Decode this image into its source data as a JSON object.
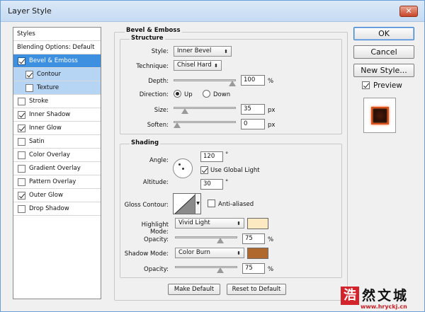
{
  "window": {
    "title": "Layer Style",
    "close": "✕"
  },
  "styles_panel": {
    "items": [
      {
        "label": "Styles",
        "kind": "plain"
      },
      {
        "label": "Blending Options: Default",
        "kind": "plain"
      },
      {
        "label": "Bevel & Emboss",
        "kind": "check",
        "checked": true,
        "state": "selected"
      },
      {
        "label": "Contour",
        "kind": "sub",
        "checked": true,
        "state": "sub-selected"
      },
      {
        "label": "Texture",
        "kind": "sub",
        "checked": false,
        "state": "sub-selected"
      },
      {
        "label": "Stroke",
        "kind": "check",
        "checked": false
      },
      {
        "label": "Inner Shadow",
        "kind": "check",
        "checked": true
      },
      {
        "label": "Inner Glow",
        "kind": "check",
        "checked": true
      },
      {
        "label": "Satin",
        "kind": "check",
        "checked": false
      },
      {
        "label": "Color Overlay",
        "kind": "check",
        "checked": false
      },
      {
        "label": "Gradient Overlay",
        "kind": "check",
        "checked": false
      },
      {
        "label": "Pattern Overlay",
        "kind": "check",
        "checked": false
      },
      {
        "label": "Outer Glow",
        "kind": "check",
        "checked": true
      },
      {
        "label": "Drop Shadow",
        "kind": "check",
        "checked": false
      }
    ]
  },
  "bevel": {
    "heading": "Bevel & Emboss",
    "structure": {
      "heading": "Structure",
      "style_label": "Style:",
      "style_value": "Inner Bevel",
      "technique_label": "Technique:",
      "technique_value": "Chisel Hard",
      "depth_label": "Depth:",
      "depth_value": "100",
      "depth_unit": "%",
      "depth_level": 1.0,
      "direction_label": "Direction:",
      "dir_up": "Up",
      "dir_down": "Down",
      "direction_selected": "Up",
      "size_label": "Size:",
      "size_value": "35",
      "size_unit": "px",
      "size_level": 0.14,
      "soften_label": "Soften:",
      "soften_value": "0",
      "soften_unit": "px",
      "soften_level": 0.0
    },
    "shading": {
      "heading": "Shading",
      "angle_label": "Angle:",
      "angle_value": "120",
      "angle_unit": "°",
      "global_light_label": "Use Global Light",
      "global_light_checked": true,
      "altitude_label": "Altitude:",
      "altitude_value": "30",
      "altitude_unit": "°",
      "gloss_label": "Gloss Contour:",
      "anti_aliased_label": "Anti-aliased",
      "anti_aliased_checked": false,
      "highlight_label": "Highlight Mode:",
      "highlight_value": "Vivid Light",
      "highlight_color": "#fce9c2",
      "hl_opacity_label": "Opacity:",
      "hl_opacity_value": "75",
      "hl_opacity_unit": "%",
      "hl_opacity_level": 0.75,
      "shadow_label": "Shadow Mode:",
      "shadow_value": "Color Burn",
      "shadow_color": "#b1682c",
      "sh_opacity_label": "Opacity:",
      "sh_opacity_value": "75",
      "sh_opacity_unit": "%",
      "sh_opacity_level": 0.75
    },
    "make_default": "Make Default",
    "reset_default": "Reset to Default"
  },
  "actions": {
    "ok": "OK",
    "cancel": "Cancel",
    "new_style": "New Style...",
    "preview_label": "Preview",
    "preview_checked": true
  },
  "watermark": {
    "logo": "浩",
    "cn": "然文城",
    "url": "www.hryckj.cn"
  }
}
